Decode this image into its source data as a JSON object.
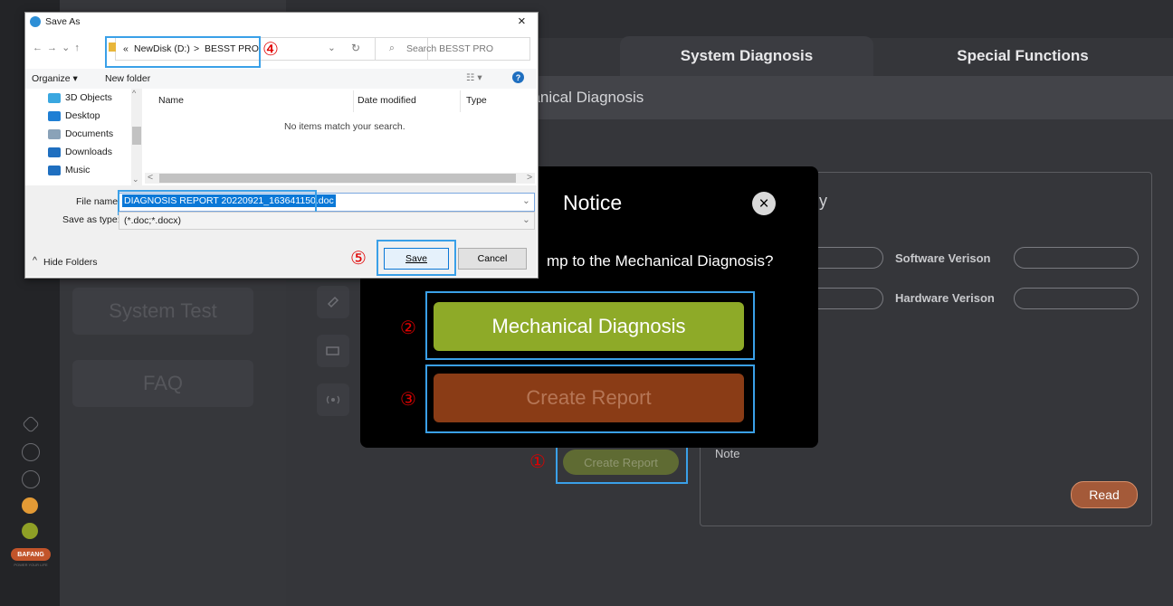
{
  "tabs": [
    {
      "label": "System Diagnosis"
    },
    {
      "label": "Special Functions"
    }
  ],
  "sub_title": "hanical Diagnosis",
  "info_box": {
    "title_fragment": "y",
    "software_label": "Software Verison",
    "hardware_label": "Hardware Verison",
    "note_label": "Note",
    "read_button": "Read"
  },
  "sidebar": {
    "system_test": "System Test",
    "faq": "FAQ",
    "logo": "BAFANG",
    "logo_sub": "POWER YOUR LIFE"
  },
  "create_report_small": "Create Report",
  "notice": {
    "title": "Notice",
    "close_glyph": "×",
    "question": "mp to the Mechanical Diagnosis?",
    "mechanical_button": "Mechanical Diagnosis",
    "report_button": "Create Report"
  },
  "annotations": {
    "n1": "①",
    "n2": "②",
    "n3": "③",
    "n4": "④",
    "n5": "⑤"
  },
  "save_dialog": {
    "title": "Save As",
    "close_glyph": "×",
    "nav_glyphs": "←  →  ⌄  ↑",
    "breadcrumb_prefix": "«",
    "breadcrumb_drive": "NewDisk (D:)",
    "breadcrumb_sep": ">",
    "breadcrumb_folder": "BESST PRO",
    "search_placeholder": "Search BESST PRO",
    "organize": "Organize ▾",
    "new_folder": "New folder",
    "help_glyph": "?",
    "tree": [
      {
        "label": "3D Objects",
        "color": "#3aa7e0"
      },
      {
        "label": "Desktop",
        "color": "#1f7fd4"
      },
      {
        "label": "Documents",
        "color": "#8aa2b8"
      },
      {
        "label": "Downloads",
        "color": "#1f6fc0"
      },
      {
        "label": "Music",
        "color": "#1f6fc0"
      }
    ],
    "columns": {
      "name": "Name",
      "date": "Date modified",
      "type": "Type"
    },
    "empty_message": "No items match your search.",
    "file_name_label": "File name:",
    "file_name_value": "DIAGNOSIS REPORT 20220921_163641150.doc",
    "save_type_label": "Save as type:",
    "save_type_value": "(*.doc;*.docx)",
    "hide_folders": "Hide Folders",
    "save_button": "Save",
    "cancel_button": "Cancel"
  },
  "colors": {
    "accent_green": "#8eaa28",
    "accent_orange": "#8a3c16",
    "highlight_blue": "#3aa0e8",
    "annotation_red": "#e00000",
    "selection_blue": "#0a78d7"
  }
}
